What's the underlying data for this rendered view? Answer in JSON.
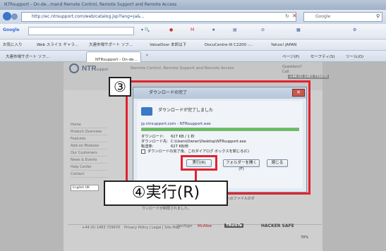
{
  "browser": {
    "title": "NTRsupport - On-de...mand Remote Control, Remote Support and Remote Access",
    "url": "http://ec.ntrsupport.com/web/catalog.jsp?lang=ja&...",
    "search_placeholder": "Google",
    "google_label": "Google",
    "favorites": [
      "お気に入り",
      "Web スライス ギャラ...",
      "大連市場サポート ソフ...",
      "ValueDoor 本訳は下",
      "DocuCentre-III C2200 -...",
      "Yahoo! JAPAN"
    ],
    "tabs": [
      "大連市場サポート ソフ...",
      "NTRsupport - On-de..."
    ],
    "page_menu": "ページ(P)",
    "safety_menu": "セーフティ(S)",
    "tools_menu": "ツール(O)",
    "status_zoom": "70%"
  },
  "site": {
    "logo": "NTR",
    "logo_sub": "support",
    "tagline": "Remote Control, Remote Support and Remote Access",
    "questions": "Questions?",
    "call": "Call",
    "phone": "+44 (0) 1483 739970",
    "nav_items": [
      "Home",
      "Product Overview",
      "Features",
      "Add-on Modules",
      "Our Customers",
      "News & Events",
      "Help Center",
      "Contact"
    ],
    "language": "English UK",
    "footer_phone": "+44 (0) 1483 739970",
    "footer_links": "Privacy Policy | Legal | Site Map",
    "trust_logos": [
      "VeriSign",
      "McAfee",
      "TRUSTe",
      "HACKER SAFE"
    ],
    "warning": "セキュリティのため、このサイトでこのコンピュータへのファイルのダウンロードが制限されました。"
  },
  "dialog": {
    "title": "ダウンロードの完了",
    "message": "ダウンロードが完了しました",
    "file": "jp.ntrsupport.com - NTRsupport.exe",
    "progress": 100,
    "rows": [
      {
        "k": "ダウンロード:",
        "v": "627 KB / 1 秒"
      },
      {
        "k": "ダウンロード先:",
        "v": "C:\\Users\\Owner\\Desktop\\NTRsupport.exe"
      },
      {
        "k": "転送率:",
        "v": "627 KB/秒"
      }
    ],
    "checkbox_label": "ダウンロードの完了後、このダイアログ ボックスを閉じる(C)",
    "btn_run": "実行(R)",
    "btn_folder": "フォルダーを開く(F)",
    "btn_close": "閉じる",
    "close_glyph": "✕"
  },
  "callouts": {
    "step3": "③",
    "step4": "④実行(R)"
  },
  "colors": {
    "highlight": "#e0242f",
    "progress": "#5fc15a"
  }
}
